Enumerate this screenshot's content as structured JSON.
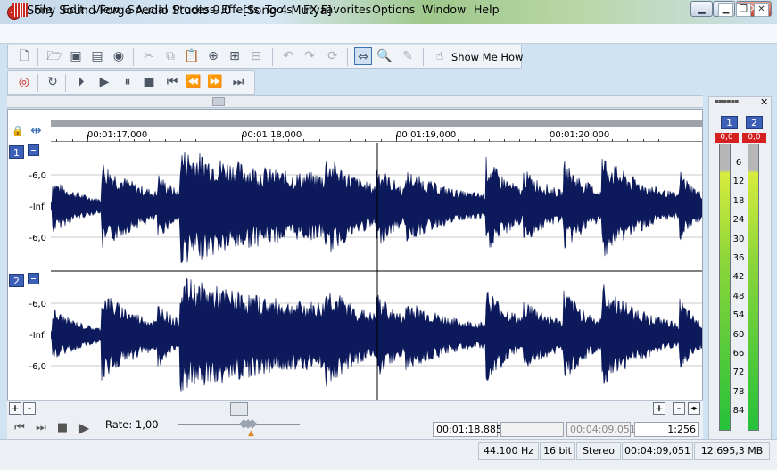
{
  "window": {
    "title": "Sony Sound Forge Audio Studio 9.0 - [Song 4 Mutya]",
    "buttons": {
      "minimize": "▁",
      "maximize": "□",
      "close": "✕"
    }
  },
  "menu": {
    "items": [
      "File",
      "Edit",
      "View",
      "Special",
      "Process",
      "Effects",
      "Tools",
      "FX Favorites",
      "Options",
      "Window",
      "Help"
    ],
    "mdi_buttons": [
      "▁",
      "❐",
      "✕"
    ]
  },
  "toolbar1": {
    "show_me_how": "Show Me How"
  },
  "timeline": {
    "labels": [
      "00:01:17,000",
      "00:01:18,000",
      "00:01:19,000",
      "00:01:20,000"
    ]
  },
  "channels": [
    {
      "number": "1",
      "axis": [
        "-6,0",
        "-Inf.",
        "-6,0"
      ]
    },
    {
      "number": "2",
      "axis": [
        "-6,0",
        "-Inf.",
        "-6,0"
      ]
    }
  ],
  "zoom": {
    "plus": "+",
    "minus": "-"
  },
  "transport": {
    "rate_label": "Rate: 1,00",
    "cursor_position": "00:01:18,885",
    "selection_length": "",
    "file_length": "00:04:09,051",
    "zoom_ratio": "1:256"
  },
  "status": {
    "sample_rate": "44.100 Hz",
    "bit_depth": "16 bit",
    "channels": "Stereo",
    "length": "00:04:09,051",
    "file_size": "12.695,3 MB"
  },
  "meters": {
    "channel_labels": [
      "1",
      "2"
    ],
    "peak_values": [
      "0,0",
      "0,0"
    ],
    "scale": [
      "6",
      "12",
      "18",
      "24",
      "30",
      "36",
      "42",
      "48",
      "54",
      "60",
      "66",
      "72",
      "78",
      "84"
    ]
  },
  "colors": {
    "waveform": "#0c1a5c",
    "channel_badge": "#3c5fb8",
    "peak": "#d62020"
  }
}
